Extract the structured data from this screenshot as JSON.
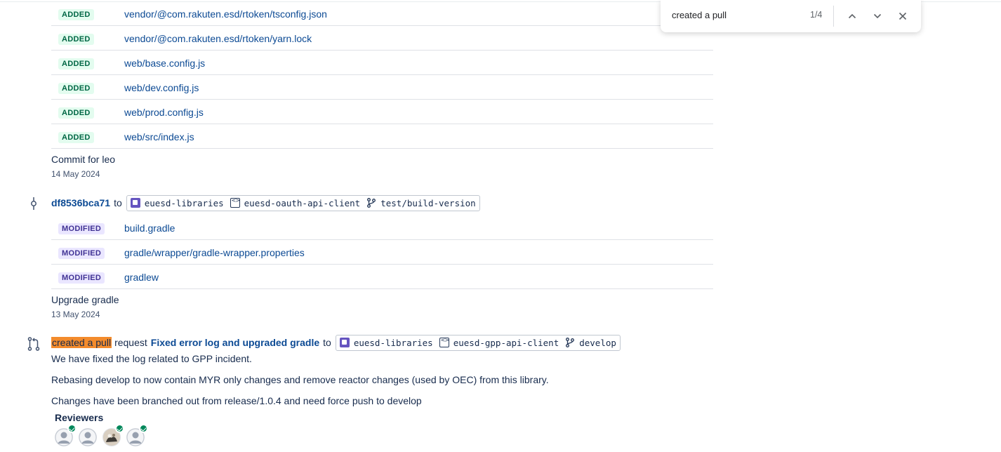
{
  "added_files": [
    {
      "status": "ADDED",
      "path": "vendor/@com.rakuten.esd/rtoken/tsconfig.json"
    },
    {
      "status": "ADDED",
      "path": "vendor/@com.rakuten.esd/rtoken/yarn.lock"
    },
    {
      "status": "ADDED",
      "path": "web/base.config.js"
    },
    {
      "status": "ADDED",
      "path": "web/dev.config.js"
    },
    {
      "status": "ADDED",
      "path": "web/prod.config.js"
    },
    {
      "status": "ADDED",
      "path": "web/src/index.js"
    }
  ],
  "commit1": {
    "message": "Commit for leo",
    "date": "14 May 2024"
  },
  "commit2": {
    "hash": "df8536bca71",
    "to": "to",
    "project": "euesd-libraries",
    "repo": "euesd-oauth-api-client",
    "branch": "test/build-version",
    "files": [
      {
        "status": "MODIFIED",
        "path": "build.gradle"
      },
      {
        "status": "MODIFIED",
        "path": "gradle/wrapper/gradle-wrapper.properties"
      },
      {
        "status": "MODIFIED",
        "path": "gradlew"
      }
    ],
    "message": "Upgrade gradle",
    "date": "13 May 2024"
  },
  "pull_request": {
    "action_highlight": "created a pull",
    "action_rest": "request",
    "title": "Fixed error log and upgraded gradle",
    "to": "to",
    "project": "euesd-libraries",
    "repo": "euesd-gpp-api-client",
    "branch": "develop",
    "description": [
      "We have fixed the log related to GPP incident.",
      "Rebasing develop to now contain MYR only changes and remove reactor changes (used by OEC) from this library.",
      "Changes have been branched out from release/1.0.4 and need force push to develop"
    ],
    "reviewers_label": "Reviewers",
    "reviewers": [
      {
        "avatar": "default-avatar",
        "approved": true
      },
      {
        "avatar": "default-avatar",
        "approved": false
      },
      {
        "avatar": "photo-avatar",
        "approved": true
      },
      {
        "avatar": "default-avatar",
        "approved": true
      }
    ]
  },
  "find_bar": {
    "query": "created a pull",
    "count": "1/4"
  },
  "colors": {
    "link": "#0c4a94",
    "added_bg": "#e3fcef",
    "added_text": "#006644",
    "modified_bg": "#eae6ff",
    "modified_text": "#403294",
    "highlight": "#f38b2c",
    "approved": "#00875a"
  }
}
